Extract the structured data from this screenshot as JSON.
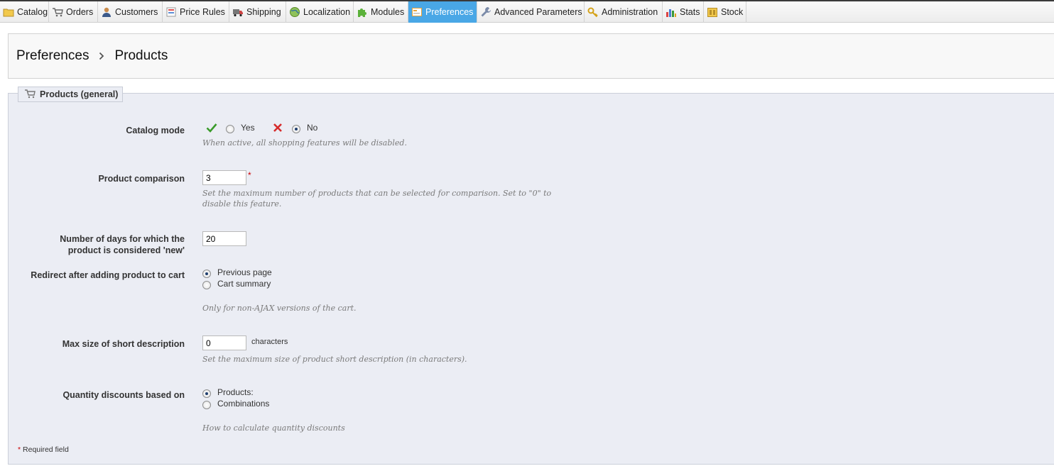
{
  "nav": {
    "tabs": [
      {
        "label": "Catalog",
        "icon": "folder-icon"
      },
      {
        "label": "Orders",
        "icon": "cart-icon"
      },
      {
        "label": "Customers",
        "icon": "user-icon"
      },
      {
        "label": "Price Rules",
        "icon": "price-rules-icon"
      },
      {
        "label": "Shipping",
        "icon": "truck-icon"
      },
      {
        "label": "Localization",
        "icon": "globe-icon"
      },
      {
        "label": "Modules",
        "icon": "puzzle-icon"
      },
      {
        "label": "Preferences",
        "icon": "preferences-icon",
        "active": true
      },
      {
        "label": "Advanced Parameters",
        "icon": "wrench-icon"
      },
      {
        "label": "Administration",
        "icon": "key-icon"
      },
      {
        "label": "Stats",
        "icon": "bar-chart-icon"
      },
      {
        "label": "Stock",
        "icon": "stock-icon"
      }
    ],
    "active_color": "#49a7e6"
  },
  "breadcrumb": {
    "parent": "Preferences",
    "current": "Products"
  },
  "section": {
    "legend": "Products (general)"
  },
  "form": {
    "catalog_mode": {
      "label": "Catalog mode",
      "yes_label": "Yes",
      "no_label": "No",
      "selected": "No",
      "hint": "When active, all shopping features will be disabled."
    },
    "product_comparison": {
      "label": "Product comparison",
      "value": "3",
      "required_mark": "*",
      "hint_line1": "Set the maximum number of products that can be selected for comparison. Set to \"0\" to",
      "hint_line2": "disable this feature."
    },
    "new_days": {
      "label_line1": "Number of days for which the",
      "label_line2": "product is considered 'new'",
      "value": "20"
    },
    "redirect": {
      "label": "Redirect after adding product to cart",
      "options": [
        "Previous page",
        "Cart summary"
      ],
      "selected": "Previous page",
      "hint": "Only for non-AJAX versions of the cart."
    },
    "short_desc": {
      "label": "Max size of short description",
      "value": "0",
      "suffix": "characters",
      "hint": "Set the maximum size of product short description (in characters)."
    },
    "qty_discounts": {
      "label": "Quantity discounts based on",
      "options": [
        "Products:",
        "Combinations"
      ],
      "selected": "Products:",
      "hint": "How to calculate quantity discounts"
    },
    "required_note": {
      "mark": "*",
      "text": "Required field"
    }
  },
  "colors": {
    "panel_bg": "#ebedf4",
    "yes_green": "#3a9b2a",
    "no_red": "#d62b2b"
  }
}
